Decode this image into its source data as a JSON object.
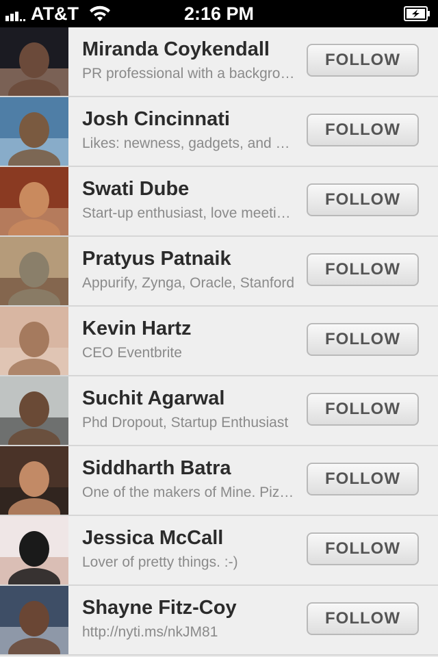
{
  "status_bar": {
    "carrier": "AT&T",
    "time": "2:16 PM"
  },
  "users": [
    {
      "name": "Miranda Coykendall",
      "bio": "PR professional with a background in tech",
      "button": "FOLLOW",
      "avatar_colors": [
        "#1b1b22",
        "#6b4a3a",
        "#c89a80"
      ]
    },
    {
      "name": "Josh Cincinnati",
      "bio": "Likes: newness, gadgets, and good food",
      "button": "FOLLOW",
      "avatar_colors": [
        "#4f7ea6",
        "#7a5a40",
        "#b8d2e6"
      ]
    },
    {
      "name": "Swati Dube",
      "bio": "Start-up enthusiast, love meeting new people",
      "button": "FOLLOW",
      "avatar_colors": [
        "#8a3a22",
        "#c98a5e",
        "#d9b08c"
      ]
    },
    {
      "name": "Pratyus Patnaik",
      "bio": "Appurify, Zynga, Oracle, Stanford",
      "button": "FOLLOW",
      "avatar_colors": [
        "#b59b7a",
        "#8a7f6a",
        "#5b3a2a"
      ]
    },
    {
      "name": "Kevin Hartz",
      "bio": "CEO Eventbrite",
      "button": "FOLLOW",
      "avatar_colors": [
        "#d8b6a2",
        "#a57a5e",
        "#e8d2c2"
      ]
    },
    {
      "name": "Suchit Agarwal",
      "bio": "Phd Dropout, Startup Enthusiast",
      "button": "FOLLOW",
      "avatar_colors": [
        "#bfc3c2",
        "#6a4a36",
        "#2b2b2b"
      ]
    },
    {
      "name": "Siddharth Batra",
      "bio": "One of the makers of Mine. Pizza lover",
      "button": "FOLLOW",
      "avatar_colors": [
        "#4a3328",
        "#c28a66",
        "#1e1a18"
      ]
    },
    {
      "name": "Jessica McCall",
      "bio": "Lover of pretty things. :-)",
      "button": "FOLLOW",
      "avatar_colors": [
        "#efe6e6",
        "#1a1a1a",
        "#c99c8c"
      ]
    },
    {
      "name": "Shayne Fitz-Coy",
      "bio": "http://nyti.ms/nkJM81",
      "button": "FOLLOW",
      "avatar_colors": [
        "#3e4e66",
        "#6a4634",
        "#cfd6de"
      ]
    }
  ]
}
